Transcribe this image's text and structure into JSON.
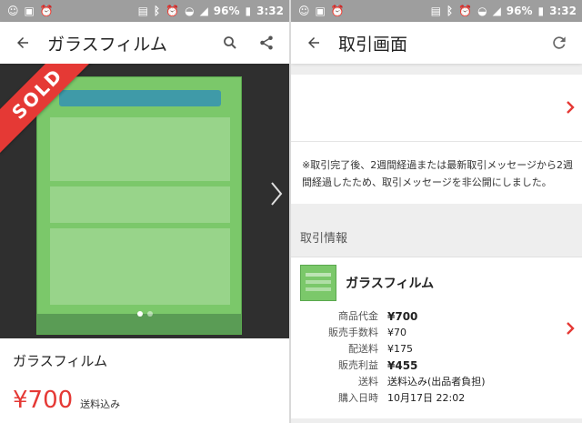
{
  "status_bar": {
    "battery": "96%",
    "time": "3:32"
  },
  "left": {
    "header": {
      "title": "ガラスフィルム",
      "back_icon": "arrow-left-icon",
      "search_icon": "search-icon",
      "share_icon": "share-icon"
    },
    "gallery": {
      "badge": "SOLD",
      "image_count": 2,
      "active_index": 0
    },
    "product": {
      "name": "ガラスフィルム",
      "price": "¥700",
      "shipping": "送料込み"
    }
  },
  "right": {
    "header": {
      "title": "取引画面",
      "back_icon": "arrow-left-icon",
      "refresh_icon": "refresh-icon"
    },
    "notice": "※取引完了後、2週間経過または最新取引メッセージから2週間経過したため、取引メッセージを非公開にしました。",
    "section_title": "取引情報",
    "trade": {
      "item_name": "ガラスフィルム",
      "rows": [
        {
          "label": "商品代金",
          "value": "¥700",
          "bold": true
        },
        {
          "label": "販売手数料",
          "value": "¥70",
          "bold": false
        },
        {
          "label": "配送料",
          "value": "¥175",
          "bold": false
        },
        {
          "label": "販売利益",
          "value": "¥455",
          "bold": true
        },
        {
          "label": "送料",
          "value": "送料込み(出品者負担)",
          "bold": false
        },
        {
          "label": "購入日時",
          "value": "10月17日 22:02",
          "bold": false
        }
      ]
    }
  },
  "colors": {
    "accent": "#e53935",
    "status_bar": "#9e9e9e",
    "section_bg": "#eeeeee"
  }
}
